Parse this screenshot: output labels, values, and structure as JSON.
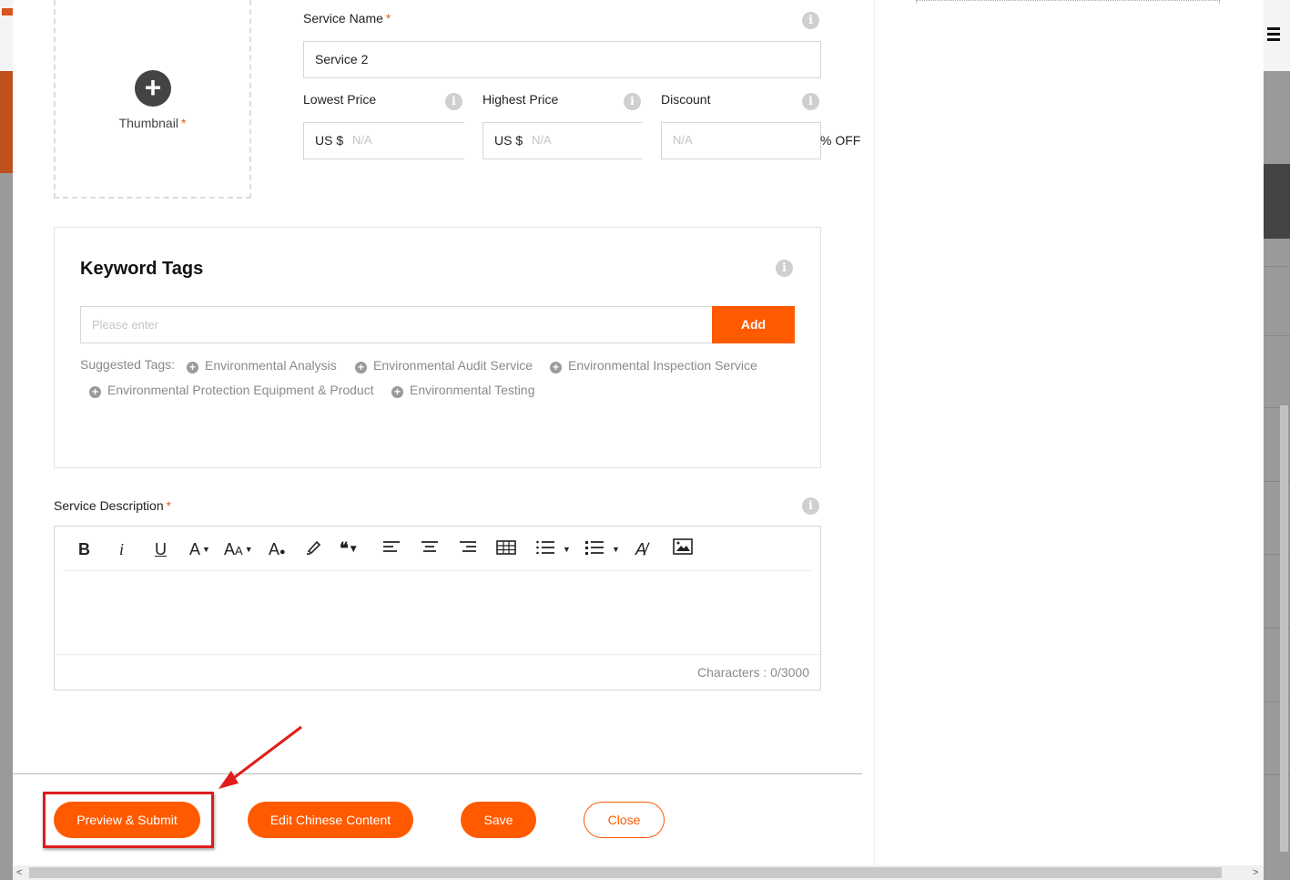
{
  "thumbnail": {
    "label": "Thumbnail",
    "required": "*"
  },
  "service_name": {
    "label": "Service Name",
    "required": "*",
    "value": "Service 2"
  },
  "lowest_price": {
    "label": "Lowest Price",
    "prefix": "US $",
    "placeholder": "N/A"
  },
  "highest_price": {
    "label": "Highest Price",
    "prefix": "US $",
    "placeholder": "N/A"
  },
  "discount": {
    "label": "Discount",
    "placeholder": "N/A",
    "suffix": "% OFF"
  },
  "keyword_tags": {
    "title": "Keyword Tags",
    "placeholder": "Please enter",
    "add_label": "Add",
    "suggested_label": "Suggested Tags:",
    "suggested": [
      "Environmental Analysis",
      "Environmental Audit Service",
      "Environmental Inspection Service",
      "Environmental Protection Equipment & Product",
      "Environmental Testing"
    ]
  },
  "description": {
    "label": "Service Description",
    "required": "*",
    "char_count": "Characters : 0/3000",
    "toolbar": [
      "bold-icon",
      "italic-icon",
      "underline-icon",
      "font-color-icon",
      "font-size-icon",
      "fill-color-icon",
      "highlighter-icon",
      "quote-icon",
      "align-left-icon",
      "align-center-icon",
      "align-right-icon",
      "table-icon",
      "ordered-list-icon",
      "bullet-list-icon",
      "clear-format-icon",
      "image-icon"
    ]
  },
  "footer": {
    "preview_submit": "Preview & Submit",
    "edit_chinese": "Edit Chinese Content",
    "save": "Save",
    "close": "Close"
  },
  "colors": {
    "accent": "#ff5a00",
    "highlight": "#e01c1c"
  }
}
